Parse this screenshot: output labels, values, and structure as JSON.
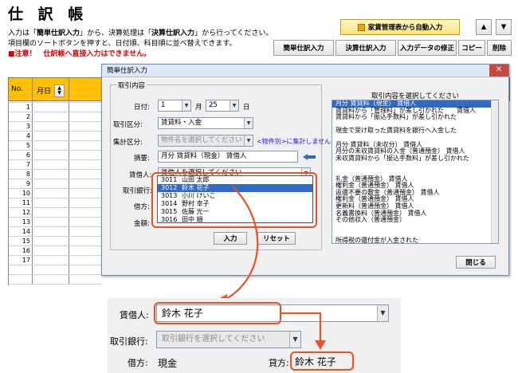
{
  "header": {
    "title": "仕 訳 帳",
    "desc1_a": "入力は「",
    "desc1_b": "簡単仕訳入力",
    "desc1_c": "」から、決算処理は「",
    "desc1_d": "決算仕訳入力",
    "desc1_e": "」から行ってください。",
    "desc2": "項目欄のソートボタンを押すと、日付順、科目順に並べ替えできます。",
    "warning": "■注意！　仕訳帳へ直接入力はできません。"
  },
  "toolbar": {
    "auto_input": "家賃管理表から自動入力",
    "up": "▲",
    "down": "▼",
    "buttons": [
      "簡単仕訳入力",
      "決算仕訳入力",
      "入力データの修正",
      "コピー",
      "削除"
    ]
  },
  "sheet": {
    "col_no": "No.",
    "col_date": "月日",
    "rows": [
      "1",
      "2",
      "3",
      "4",
      "5",
      "6",
      "7",
      "8",
      "9",
      "10",
      "11",
      "12",
      "13",
      "14",
      "15",
      "16",
      "17"
    ]
  },
  "dialog": {
    "title": "簡単仕訳入力",
    "close": "✕",
    "group_label": "取引内容",
    "date_label": "日付:",
    "month": "1",
    "month_unit": "月",
    "day": "25",
    "day_unit": "日",
    "kubun_label": "取引区分:",
    "kubun_value": "賃貸料・入金",
    "shuukei_label": "集計区分:",
    "shuukei_value": "物件名を選択してください",
    "shuukei_note": "<物件別>に集計しません",
    "tekiyou_label": "摘要:",
    "tekiyou_value": "月分  賃貸料（現金）  賃借人",
    "tenant_label": "賃借人:",
    "tenant_value": "賃借人を選択してください",
    "bank_label": "取引銀行:",
    "karikata_label": "借方:",
    "kingaku_label": "金額:",
    "input_btn": "入力",
    "reset_btn": "リセット",
    "right_title": "取引内容を選択してください",
    "options": [
      "月分  賃貸料（現金）  賃借人",
      "賃貸料から「管理料」が差し引かれた　　賃借人",
      "賃貸料から「振込手数料」が差し引かれた",
      "",
      "現金で受け取った賃貸料を銀行へ入金した",
      "",
      "月分  賃貸料（未収分）  賃借人",
      "月分の未収賃貸料の入金（普通預金）  賃借人",
      "未収賃貸料から「振込手数料」が差し引かれた",
      "",
      "",
      "礼金（普通預金）  賃借人",
      "権利金（普通預金）  賃借人",
      "返還不要の敷金（普通預金）  賃借人",
      "権利金（普通預金）  賃借人",
      "更新料（普通預金）  賃借人",
      "名義書換料（普通預金）  賃借人",
      "その他収入（普通預金）",
      "",
      "",
      "所得税の還付金が入金された"
    ],
    "close_btn": "閉じる"
  },
  "tenant_list": [
    {
      "code": "3011",
      "name": "山田 太郎"
    },
    {
      "code": "3012",
      "name": "鈴木 花子"
    },
    {
      "code": "3013",
      "name": "小川 けいこ"
    },
    {
      "code": "3014",
      "name": "野村 幸子"
    },
    {
      "code": "3015",
      "name": "佐藤 光一"
    },
    {
      "code": "3016",
      "name": "田中 順"
    }
  ],
  "zoom": {
    "tenant_label": "賃借人:",
    "tenant_value": "鈴木 花子",
    "bank_label": "取引銀行:",
    "bank_value": "取引銀行を選択してください",
    "karikata_label": "借方:",
    "karikata_value": "現金",
    "kashikata_label": "貸方:",
    "kashikata_value": "鈴木 花子"
  },
  "colors": {
    "accent_orange": "#f05022",
    "header_yellow": "#ffc000",
    "selection_blue": "#3169c6",
    "warning_red": "#e00000"
  }
}
